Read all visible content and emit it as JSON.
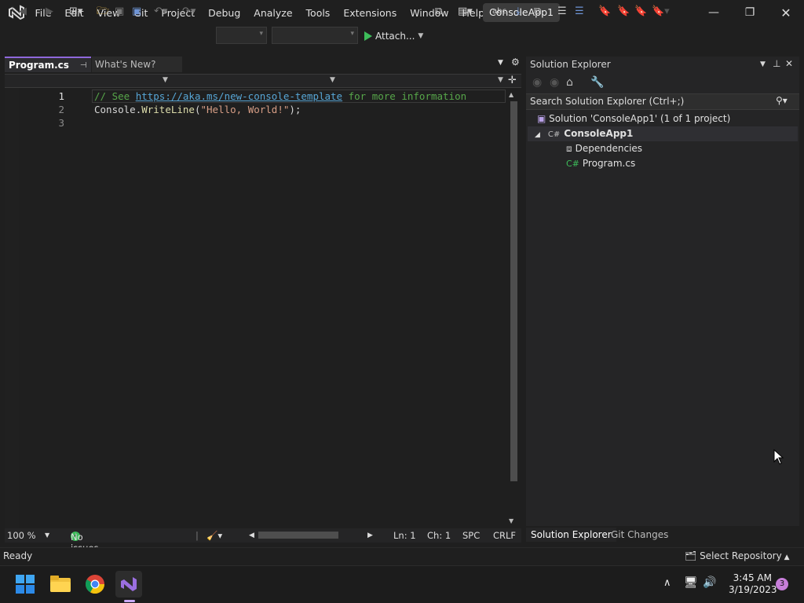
{
  "menu": [
    "File",
    "Edit",
    "View",
    "Git",
    "Project",
    "Debug",
    "Analyze",
    "Tools",
    "Extensions",
    "Window",
    "Help"
  ],
  "solution_name": "ConsoleApp1",
  "toolbar": {
    "attach_label": "Attach..."
  },
  "tabs": [
    {
      "label": "Program.cs",
      "active": true
    },
    {
      "label": "What's New?",
      "active": false
    }
  ],
  "code": {
    "line_numbers": [
      "1",
      "2",
      "3"
    ],
    "line1_comment_prefix": "// See ",
    "line1_link": "https://aka.ms/new-console-template",
    "line1_comment_suffix": " for more information",
    "line2_object": "Console",
    "line2_dot": ".",
    "line2_method": "WriteLine",
    "line2_open": "(",
    "line2_string": "\"Hello, World!\"",
    "line2_close": ");"
  },
  "editor_status": {
    "zoom": "100 %",
    "issues": "No issues found",
    "ln": "Ln: 1",
    "ch": "Ch: 1",
    "spc": "SPC",
    "crlf": "CRLF"
  },
  "solution_explorer": {
    "title": "Solution Explorer",
    "search_placeholder": "Search Solution Explorer (Ctrl+;)",
    "solution_label": "Solution 'ConsoleApp1' (1 of 1 project)",
    "project_label": "ConsoleApp1",
    "dependencies_label": "Dependencies",
    "file_label": "Program.cs",
    "bottom_tabs": [
      "Solution Explorer",
      "Git Changes"
    ]
  },
  "status": {
    "ready": "Ready",
    "select_repo": "Select Repository"
  },
  "taskbar": {
    "time": "3:45 AM",
    "date": "3/19/2023",
    "notifications": "3"
  },
  "colors": {
    "accent": "#8f68dc",
    "comment": "#57a64a",
    "link": "#57a6d6",
    "string": "#d69d85",
    "method": "#dcdcaa",
    "success": "#3dbd5a"
  }
}
